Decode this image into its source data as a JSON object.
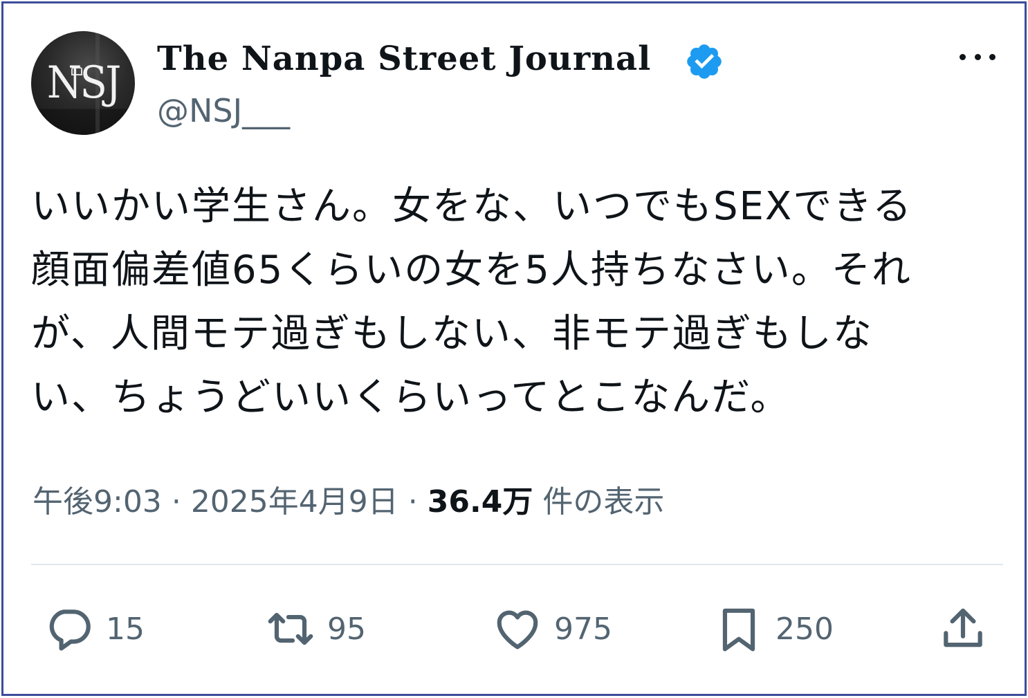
{
  "account": {
    "avatar_text": "NSJ",
    "display_name": "The Nanpa Street Journal",
    "handle": "@NSJ___",
    "verified_color": "#1d9bf0"
  },
  "tweet": {
    "lines": [
      "いいかい学生さん。女をな、いつでもSEXできる",
      "顔面偏差値65くらいの女を5人持ちなさい。それ",
      "が、人間モテ過ぎもしない、非モテ過ぎもしな",
      "い、ちょうどいいくらいってとこなんだ。"
    ]
  },
  "meta": {
    "time": "午後9:03",
    "separator": "·",
    "date": "2025年4月9日",
    "views_count": "36.4万",
    "views_label": "件の表示"
  },
  "actions": {
    "reply_count": "15",
    "retweet_count": "95",
    "like_count": "975",
    "bookmark_count": "250"
  },
  "icons": {
    "more": "more-icon",
    "reply": "reply-icon",
    "retweet": "retweet-icon",
    "like": "heart-icon",
    "bookmark": "bookmark-icon",
    "share": "share-icon"
  }
}
